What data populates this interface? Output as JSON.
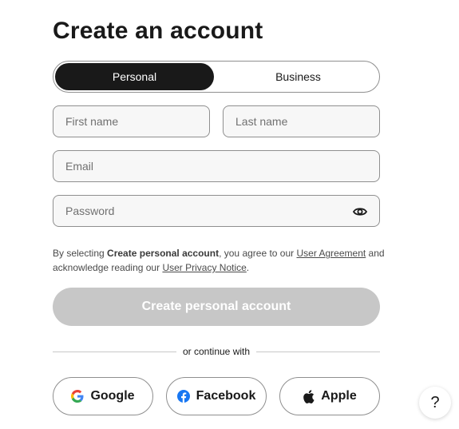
{
  "page": {
    "title": "Create an account"
  },
  "account_type": {
    "options": [
      {
        "label": "Personal",
        "selected": true
      },
      {
        "label": "Business",
        "selected": false
      }
    ]
  },
  "form": {
    "first_name": {
      "value": "",
      "placeholder": "First name"
    },
    "last_name": {
      "value": "",
      "placeholder": "Last name"
    },
    "email": {
      "value": "",
      "placeholder": "Email"
    },
    "password": {
      "value": "",
      "placeholder": "Password",
      "toggle_icon": "eye-icon"
    }
  },
  "legal": {
    "prefix": "By selecting ",
    "bold": "Create personal account",
    "middle": ", you agree to our ",
    "agreement_link": "User Agreement",
    "middle2": " and acknowledge reading our ",
    "privacy_link": "User Privacy Notice",
    "suffix": "."
  },
  "create_button": {
    "label": "Create personal account",
    "disabled": true
  },
  "divider": {
    "label": "or continue with"
  },
  "social": [
    {
      "label": "Google",
      "icon": "google-icon"
    },
    {
      "label": "Facebook",
      "icon": "facebook-icon"
    },
    {
      "label": "Apple",
      "icon": "apple-icon"
    }
  ],
  "help": {
    "label": "?"
  },
  "colors": {
    "primary": "#191919",
    "disabled_button": "#c7c7c7",
    "field_bg": "#f7f7f7",
    "facebook_blue": "#1877f2"
  }
}
